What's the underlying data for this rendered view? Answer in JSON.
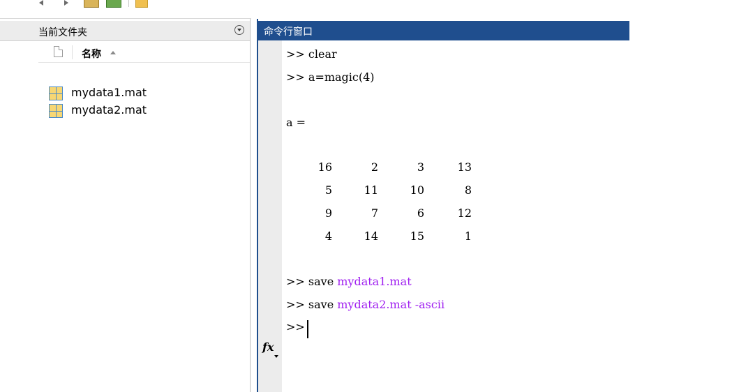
{
  "toolbar": {
    "icons": [
      "back-arrow-icon",
      "forward-arrow-icon",
      "up-folder-icon",
      "browse-folder-icon",
      "folder-icon"
    ]
  },
  "folder_panel": {
    "title": "当前文件夹",
    "column_name": "名称",
    "files": [
      {
        "name": "mydata1.mat",
        "icon": "mat-file-icon"
      },
      {
        "name": "mydata2.mat",
        "icon": "mat-file-icon"
      }
    ]
  },
  "command_window": {
    "title": "命令行窗口",
    "lines": {
      "l1_prompt": ">>",
      "l1_cmd": " clear",
      "l2_prompt": ">>",
      "l2_cmd": " a=magic(4)",
      "l3": "a =",
      "l4_prompt": ">>",
      "l4_cmd": " save ",
      "l4_arg": "mydata1.mat",
      "l5_prompt": ">>",
      "l5_cmd": " save ",
      "l5_arg": "mydata2.mat -ascii",
      "current_prompt": ">>"
    },
    "matrix": [
      [
        "16",
        "2",
        "3",
        "13"
      ],
      [
        "5",
        "11",
        "10",
        "8"
      ],
      [
        "9",
        "7",
        "6",
        "12"
      ],
      [
        "4",
        "14",
        "15",
        "1"
      ]
    ],
    "fx_label": "fx"
  },
  "colors": {
    "header_blue": "#1f4e8e",
    "string_purple": "#a020f0",
    "gutter_gray": "#ececec"
  }
}
